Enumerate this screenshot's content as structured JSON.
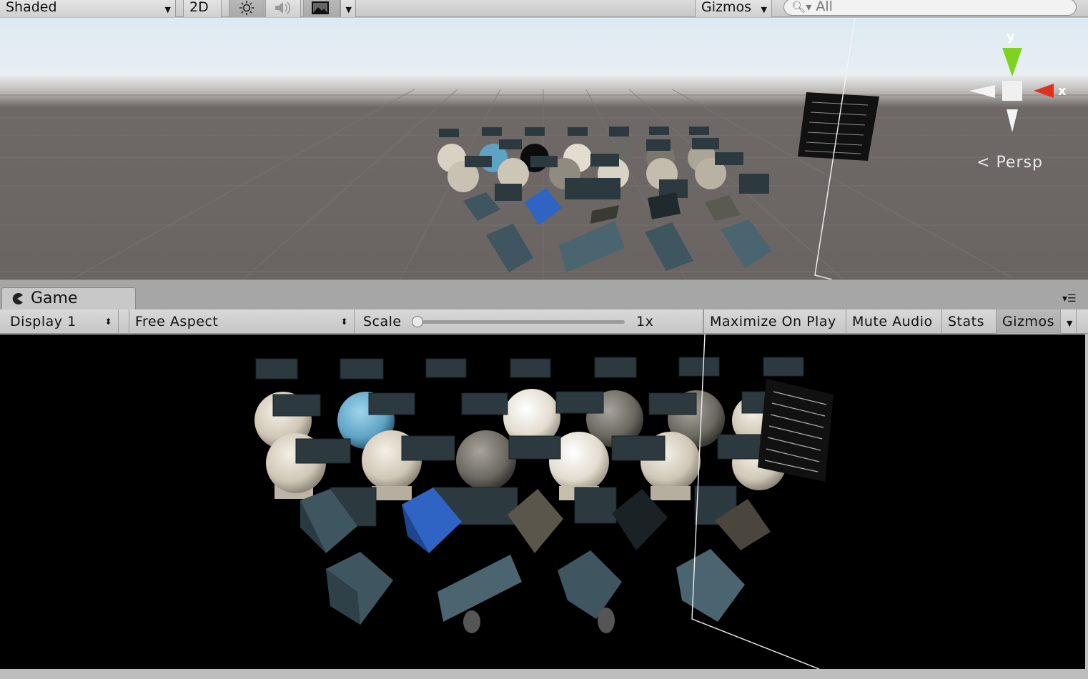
{
  "scene_toolbar": {
    "shading_mode": "Shaded",
    "mode_2d": "2D",
    "gizmos": "Gizmos",
    "search_placeholder": "All"
  },
  "scene_view": {
    "projection": "Persp",
    "gizmo_axes": {
      "y": "y",
      "x": "x"
    }
  },
  "game_tab": {
    "label": "Game"
  },
  "game_toolbar": {
    "display": "Display 1",
    "aspect": "Free Aspect",
    "scale_label": "Scale",
    "scale_value": "1x",
    "scale_fraction": 0.0,
    "maximize_on_play": "Maximize On Play",
    "mute_audio": "Mute Audio",
    "stats": "Stats",
    "gizmos": "Gizmos"
  },
  "colors": {
    "sphere_cream": "#d8d2c4",
    "sphere_blue": "#5fa3c4",
    "cube_teal": "#3f5560",
    "cube_blue": "#2f63c4",
    "label_panel": "#2c3a40",
    "gizmo_y": "#7ed321",
    "gizmo_x": "#e0301e"
  }
}
